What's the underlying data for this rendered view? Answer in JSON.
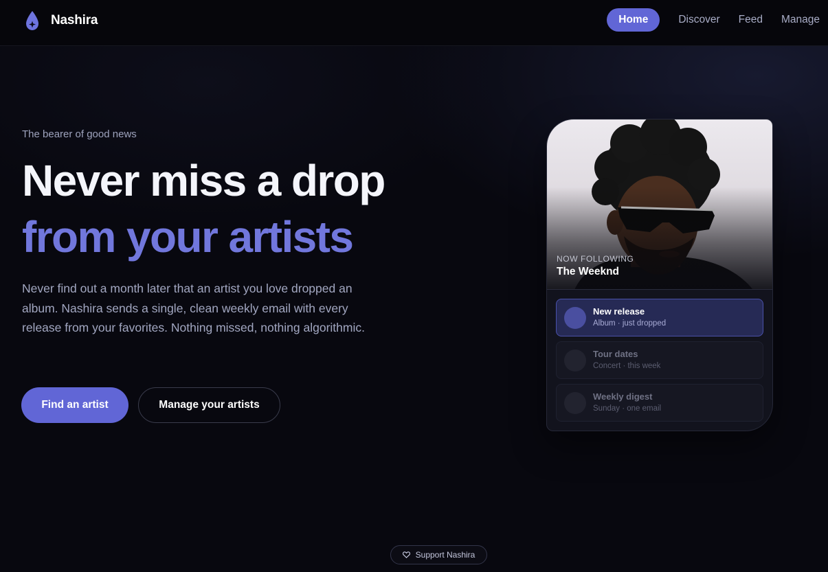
{
  "brand": {
    "name": "Nashira",
    "logo_icon": "droplet-sparkle-icon",
    "accent": "#6166d6"
  },
  "nav": {
    "items": [
      {
        "label": "Home",
        "active": true
      },
      {
        "label": "Discover",
        "active": false
      },
      {
        "label": "Feed",
        "active": false
      },
      {
        "label": "Manage",
        "active": false
      }
    ]
  },
  "hero": {
    "eyebrow": "The bearer of good news",
    "headline_line1": "Never miss a drop",
    "headline_line2": "from your artists",
    "body": "Never find out a month later that an artist you love dropped an album. Nashira sends a single, clean weekly email with every release from your favorites. Nothing missed, nothing algorithmic.",
    "primary_button": "Find an artist",
    "secondary_button": "Manage your artists"
  },
  "card": {
    "label": "NOW FOLLOWING",
    "artist": "The Weeknd",
    "notifications": [
      {
        "title": "New release",
        "subtitle": "Album · just dropped",
        "active": true
      },
      {
        "title": "Tour dates",
        "subtitle": "Concert · this week",
        "active": false
      },
      {
        "title": "Weekly digest",
        "subtitle": "Sunday · one email",
        "active": false
      }
    ]
  },
  "footer": {
    "support_label": "Support Nashira",
    "support_icon": "heart-icon"
  }
}
